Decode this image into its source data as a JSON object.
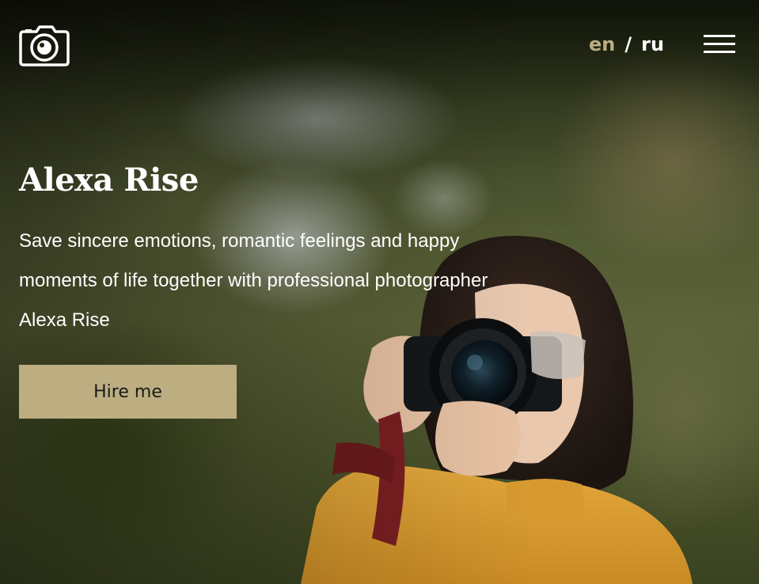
{
  "header": {
    "logo_icon": "camera-icon",
    "language": {
      "active": "en",
      "separator": "/",
      "other": "ru"
    },
    "menu_icon": "hamburger-menu-icon"
  },
  "hero": {
    "title": "Alexa Rise",
    "subtitle": "Save sincere emotions, romantic feelings and happy moments of life together with professional photographer Alexa Rise",
    "button_label": "Hire me"
  },
  "colors": {
    "accent": "#bdae82",
    "text": "#ffffff",
    "button_text": "#1a1a1a"
  }
}
